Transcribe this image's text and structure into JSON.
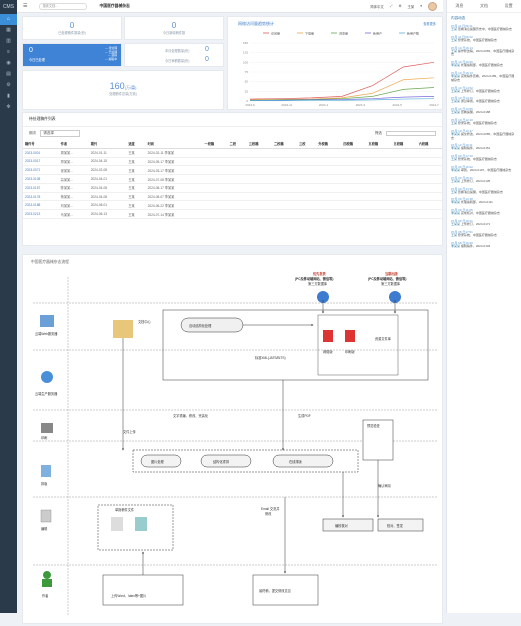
{
  "sidebar": {
    "logo": "CMS",
    "icons": [
      "home-icon",
      "grid-icon",
      "chart-icon",
      "list-icon",
      "user-icon",
      "doc-icon",
      "settings-icon",
      "bar-icon",
      "gear-icon"
    ]
  },
  "topbar": {
    "menu": "☰",
    "search_placeholder": "搜索文档…",
    "title": "中国医疗器械杂志",
    "lang": "简体中文",
    "username": "王某"
  },
  "stats": {
    "a_value": "0",
    "a_label": "已处理稿件数量(份)",
    "b_value": "0",
    "b_label": "今日新增稿件数",
    "c_value": "0",
    "c_label": "今日已处理",
    "c_right1": "— 待处理",
    "c_right2": "— 已处理",
    "c_right3": "— 退稿",
    "c_right4": "— 编辑中",
    "d_value": "0",
    "d_label": "本月处理数量(份)",
    "e_value": "0",
    "e_label": "今日审稿数量(份)",
    "total_value": "160",
    "total_unit": "(万/篇)",
    "total_label": "处理稿件总量(万篇)"
  },
  "chart_title": "网络访问量趋势统计",
  "chart_btn": "查看更多",
  "chart_data": {
    "type": "line",
    "x": [
      "2023-9",
      "2023-11",
      "2024-1",
      "2024-3",
      "2024-5",
      "2024-7"
    ],
    "ylim": [
      0,
      150
    ],
    "yticks": [
      "150",
      "125",
      "100",
      "75",
      "50",
      "25",
      "0"
    ],
    "series": [
      {
        "name": "访问量",
        "color": "#e05a5a",
        "values": [
          5,
          6,
          8,
          12,
          40,
          88,
          100
        ]
      },
      {
        "name": "下载量",
        "color": "#f0a64a",
        "values": [
          3,
          4,
          5,
          8,
          20,
          55,
          60
        ]
      },
      {
        "name": "浏览量",
        "color": "#6aa84f",
        "values": [
          2,
          3,
          4,
          6,
          12,
          30,
          35
        ]
      },
      {
        "name": "新用户",
        "color": "#7a6ad8",
        "values": [
          1,
          2,
          3,
          4,
          6,
          10,
          12
        ]
      },
      {
        "name": "新用户数",
        "color": "#5ab0d8",
        "values": [
          1,
          1,
          2,
          2,
          3,
          5,
          6
        ]
      }
    ]
  },
  "table": {
    "title": "待处理稿件列表",
    "filter_label": "期次",
    "filter_value": "请选择",
    "search_label": "筛选",
    "headers": [
      "稿件号",
      "作者",
      "期刊",
      "进度",
      "时间",
      "一校稿",
      "二校",
      "三校稿",
      "二校稿",
      "三校",
      "外校稿",
      "四校稿",
      "五校稿",
      "五校稿",
      "六校稿"
    ],
    "rows": [
      [
        "2023-0001",
        "周某某...",
        "2024-01-11",
        "王某",
        "2024-02-11 李某某"
      ],
      [
        "2023-0017",
        "郑某某...",
        "2024-04-15",
        "王某",
        "2024-05-17 李某某"
      ],
      [
        "2023-0071",
        "张某某...",
        "2024-02-08",
        "王某",
        "2024-03-17 李某某"
      ],
      [
        "2023-0108",
        "高某某...",
        "2024-04-01",
        "王某",
        "2024-07-08 李某某"
      ],
      [
        "2023-0157",
        "陈某某...",
        "2024-04-08",
        "王某",
        "2024-08-17 李某某"
      ],
      [
        "2023-0178",
        "杨某某...",
        "2024-04-08",
        "王某",
        "2024-08-07 李某某"
      ],
      [
        "2023-0188",
        "刘某某...",
        "2024-06-01",
        "王某",
        "2024-06-22 李某某"
      ],
      [
        "2023-0213",
        "马某某...",
        "2024-06-13",
        "王某",
        "2024-07-14 李某某"
      ]
    ]
  },
  "diagram": {
    "title": "中国医疗器械杂志流程",
    "cloud_web": "云端Web服务器",
    "cloud_prod": "云端生产服务器",
    "print": "印刷",
    "typeset": "排版",
    "edit": "编辑",
    "author": "作者",
    "dept1": "优先发表",
    "dept1_sub": "(PC及移动端网站、微信等)",
    "dept1_db": "第三方数据库",
    "dept2": "当期出版",
    "dept2_sub": "(PC及移动端网站、微信等)",
    "dept2_db": "第三方数据库",
    "auto": "自动结构化处理",
    "center": "文档中心",
    "fmt": "标准XML(JATS/BITS)",
    "resource": "资源文件库",
    "web": "网络版",
    "print_ver": "印刷版",
    "img": "图片处理",
    "struct": "结构化重排",
    "online": "在线排版",
    "preview": "预览检查",
    "proof": "编校核对",
    "approve": "校对、签发",
    "uploadfile": "单篇稿件文件",
    "authorfile": "上传Word、latex等+图片",
    "edit_done": "最终稿，提交修改意见",
    "l_upload": "文件上传",
    "l_text": "文字重编、修改、完善化",
    "l_pdf": "生成PDF",
    "l_confirm": "确认审阅",
    "l_email": "Email 交流并",
    "l_revise": "修改"
  },
  "right": {
    "tabs": [
      "消息",
      "文档",
      "设置"
    ],
    "header": "内容动态",
    "news": [
      {
        "t": "07月 11 日09:41",
        "a": "王某",
        "b": "查看消息提醒历史中，中国医疗器械杂志"
      },
      {
        "t": "07月 11 日09:30",
        "a": "王某",
        "b": "登录系统，中国医疗器械杂志"
      },
      {
        "t": "07月 10 日16:14",
        "a": "王某",
        "b": "操作修改稿，2024-0083，中国医疗器械杂志"
      },
      {
        "t": "07月 10 日16:09",
        "a": "李某某",
        "b": "处理编辑部，中国医疗器械杂志"
      },
      {
        "t": "07月 10 日15:13",
        "a": "李某某",
        "b": "完成稿件查看，2024-0189，中国医疗器械杂志"
      },
      {
        "t": "07月 10 日14:52",
        "a": "王某某",
        "b": "上传修订，中国医疗器械杂志"
      },
      {
        "t": "07月 10 日14:16",
        "a": "王某某",
        "b": "通过审阅，中国医疗器械杂志"
      },
      {
        "t": "07月 10 日13:55",
        "a": "王某某",
        "b": "查看提醒，2024-0188"
      },
      {
        "t": "07月 10 日12:10",
        "a": "王某",
        "b": "登录系统，中国医疗器械杂志"
      },
      {
        "t": "07月 10 日10:47",
        "a": "李某某",
        "b": "提交修改，2024-0085，中国医疗器械杂志"
      },
      {
        "t": "07月 10 日10:11",
        "a": "李某某",
        "b": "编辑稿件，2024-0151"
      },
      {
        "t": "07月 09 日17:20",
        "a": "王某",
        "b": "登录系统，中国医疗器械杂志"
      },
      {
        "t": "07月 09 日16:02",
        "a": "李某某",
        "b": "审阅，2024-0197，中国医疗器械杂志"
      },
      {
        "t": "07月 09 日15:41",
        "a": "王某某",
        "b": "上传修订，2024-0135"
      },
      {
        "t": "07月 09 日14:30",
        "a": "王某",
        "b": "查看消息提醒，中国医疗器械杂志"
      },
      {
        "t": "07月 09 日13:18",
        "a": "李某某",
        "b": "处理编辑部，2024-0111"
      },
      {
        "t": "07月 09 日11:05",
        "a": "李某某",
        "b": "完成核对，中国医疗器械杂志"
      },
      {
        "t": "07月 09 日10:21",
        "a": "王某某",
        "b": "上传修订，2024-0171"
      },
      {
        "t": "07月 08 日17:51",
        "a": "王某",
        "b": "登录系统，中国医疗器械杂志"
      },
      {
        "t": "07月 08 日16:30",
        "a": "李某某",
        "b": "编辑稿件，2024-0103"
      }
    ]
  }
}
